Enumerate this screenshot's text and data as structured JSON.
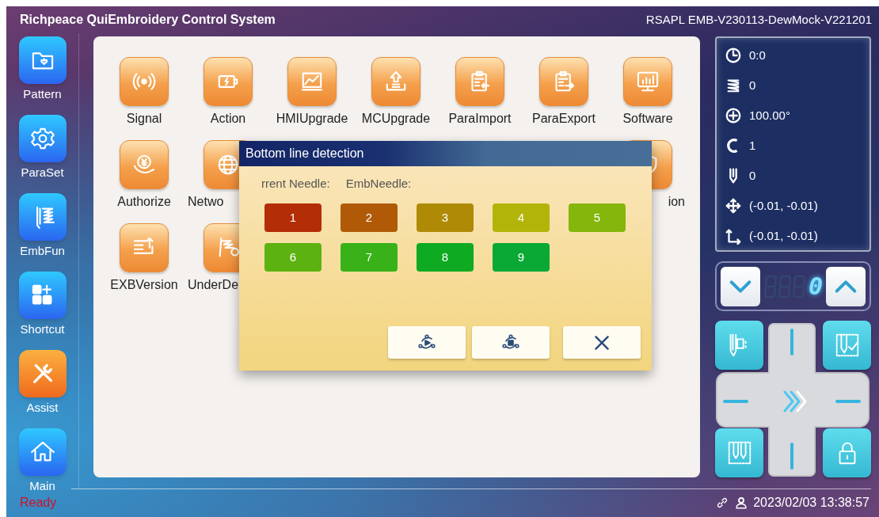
{
  "header": {
    "title": "Richpeace QuiEmbroidery Control System",
    "version": "RSAPL EMB-V230113-DewMock-V221201"
  },
  "sidebar": {
    "items": [
      {
        "label": "Pattern",
        "selected": false
      },
      {
        "label": "ParaSet",
        "selected": false
      },
      {
        "label": "EmbFun",
        "selected": false
      },
      {
        "label": "Shortcut",
        "selected": false
      },
      {
        "label": "Assist",
        "selected": true
      },
      {
        "label": "Main",
        "selected": false
      }
    ]
  },
  "functions": {
    "rows": [
      [
        {
          "label": "Signal"
        },
        {
          "label": "Action"
        },
        {
          "label": "HMIUpgrade"
        },
        {
          "label": "MCUpgrade"
        },
        {
          "label": "ParaImport"
        },
        {
          "label": "ParaExport"
        },
        {
          "label": "Software"
        }
      ],
      [
        {
          "label": "Authorize"
        },
        {
          "label": "Netwo",
          "clipped_right": true
        },
        {
          "label": "ion",
          "clipped_left": true
        }
      ],
      [
        {
          "label": "EXBVersion"
        },
        {
          "label": "UnderDe",
          "clipped_right": true
        }
      ]
    ]
  },
  "dialog": {
    "title": "Bottom line detection",
    "info": [
      "rrent Needle:",
      "EmbNeedle:"
    ],
    "needles": [
      {
        "label": "1",
        "color": "#b32d06"
      },
      {
        "label": "2",
        "color": "#b05a08"
      },
      {
        "label": "3",
        "color": "#ae8a06"
      },
      {
        "label": "4",
        "color": "#b2b40a"
      },
      {
        "label": "5",
        "color": "#84b60c"
      },
      {
        "label": "6",
        "color": "#5cb210"
      },
      {
        "label": "7",
        "color": "#38b218"
      },
      {
        "label": "8",
        "color": "#0eaa22"
      },
      {
        "label": "9",
        "color": "#0aa834"
      }
    ],
    "buttons": [
      {
        "kind": "play"
      },
      {
        "kind": "stop"
      },
      {
        "kind": "close"
      }
    ]
  },
  "status_panel": {
    "rows": [
      {
        "kind": "time",
        "value": "0:0"
      },
      {
        "kind": "stitches",
        "value": "0"
      },
      {
        "kind": "speed",
        "value": "100.00°"
      },
      {
        "kind": "color",
        "value": "1"
      },
      {
        "kind": "needle",
        "value": "0"
      },
      {
        "kind": "position",
        "value": "(-0.01, -0.01)"
      },
      {
        "kind": "origin",
        "value": "(-0.01, -0.01)"
      }
    ]
  },
  "counter": {
    "value": "0"
  },
  "status_bar": {
    "state": "Ready",
    "datetime": "2023/02/03 13:38:57"
  }
}
